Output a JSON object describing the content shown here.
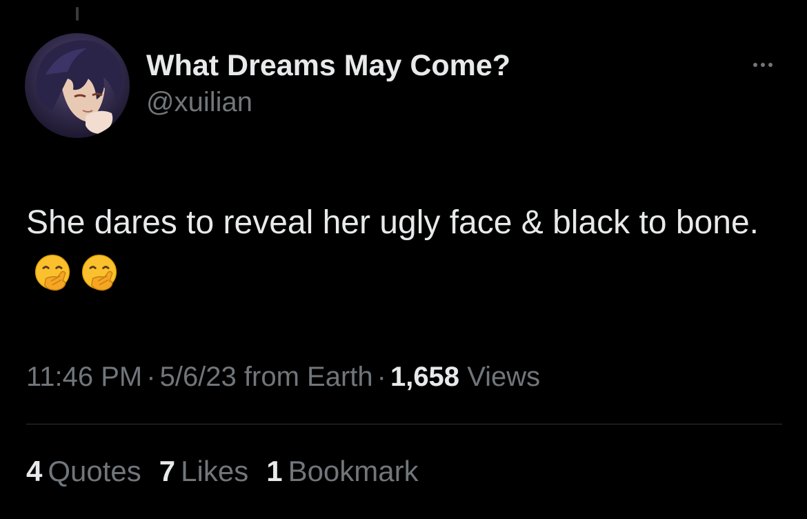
{
  "colors": {
    "background": "#000000",
    "primary_text": "#e7e9ea",
    "secondary_text": "#71767b",
    "divider": "#2f3336"
  },
  "author": {
    "display_name": "What Dreams May Come?",
    "handle": "@xuilian",
    "avatar_icon": "anime-character-avatar"
  },
  "more_icon": "ellipsis-icon",
  "tweet": {
    "text": "She dares to reveal her ugly face & black to bone.",
    "emojis": [
      "face-with-hand-over-mouth-emoji",
      "face-with-hand-over-mouth-emoji"
    ]
  },
  "meta": {
    "time": "11:46 PM",
    "separator": "·",
    "date_source": "5/6/23 from Earth",
    "views_count": "1,658",
    "views_label": "Views"
  },
  "stats": [
    {
      "count": "4",
      "label": "Quotes"
    },
    {
      "count": "7",
      "label": "Likes"
    },
    {
      "count": "1",
      "label": "Bookmark"
    }
  ]
}
